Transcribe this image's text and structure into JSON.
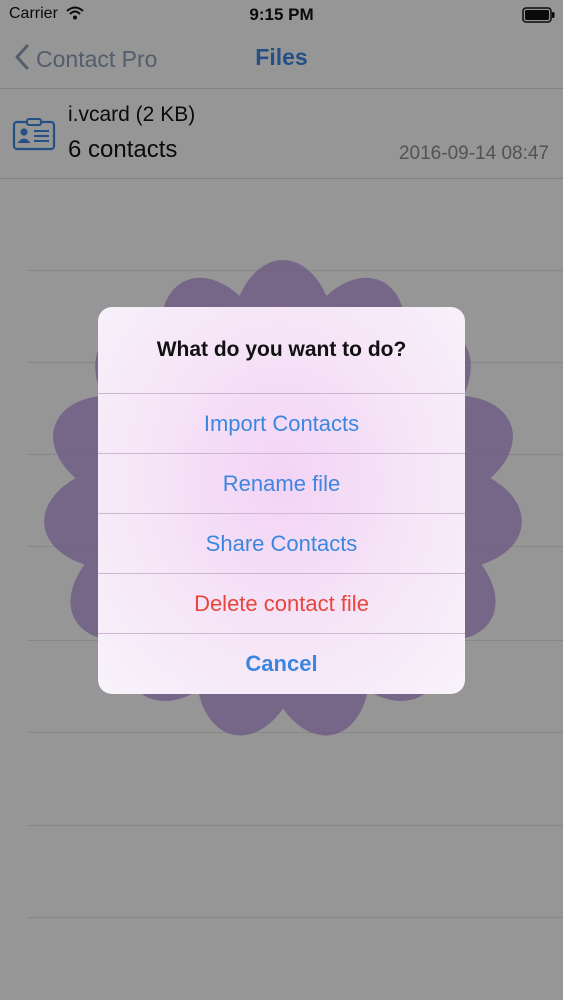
{
  "status_bar": {
    "carrier": "Carrier",
    "time": "9:15 PM",
    "icons": [
      "wifi-icon",
      "battery-icon"
    ]
  },
  "nav": {
    "back_label": "Contact Pro",
    "title": "Files",
    "back_icon": "chevron-left-icon"
  },
  "file": {
    "name": "i.vcard (2 KB)",
    "count": "6 contacts",
    "date": "2016-09-14 08:47",
    "icon": "vcard-icon"
  },
  "alert": {
    "title": "What do you want to do?",
    "actions": [
      {
        "label": "Import Contacts"
      },
      {
        "label": "Rename file"
      },
      {
        "label": "Share Contacts"
      },
      {
        "label": "Delete contact file"
      },
      {
        "label": "Cancel"
      }
    ]
  },
  "colors": {
    "accent": "#3d86e0",
    "destructive": "#e8453c",
    "flower": "#b08cd8"
  }
}
